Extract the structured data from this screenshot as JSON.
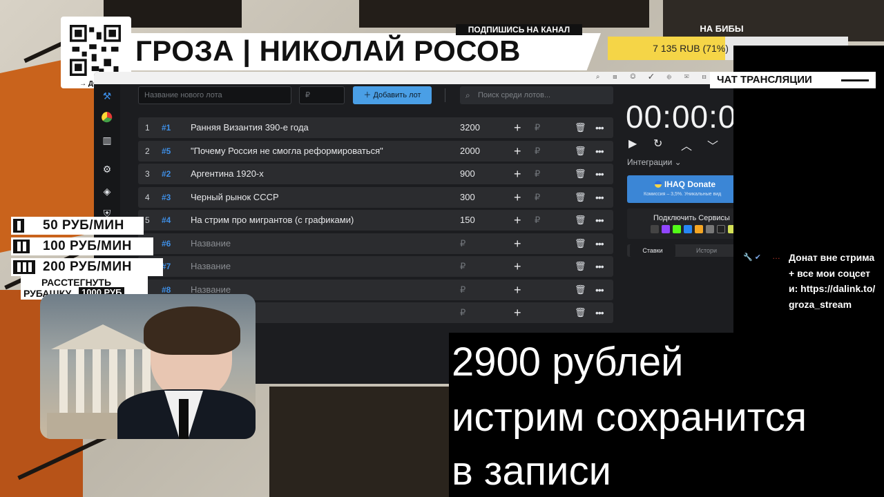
{
  "overlay": {
    "qr_label": "→ ДОНАТ",
    "title": "ГРОЗА | НИКОЛАЙ РОСОВ",
    "subscribe": "ПОДПИШИСЬ НА КАНАЛ",
    "goal": {
      "title": "НА БИБЫ",
      "text": "7 135 RUB (71%)",
      "progress": 0.71
    },
    "prices": [
      {
        "label": "50 РУБ/МИН"
      },
      {
        "label": "100 РУБ/МИН"
      },
      {
        "label": "200 РУБ/МИН"
      }
    ],
    "shirt": {
      "line1": "РАССТЕГНУТЬ",
      "line2": "РУБАШКУ",
      "badge": "1000 РУБ"
    }
  },
  "app": {
    "topbar_icons": "⌕ ⊞ ◎ ✓ ⊕ ✉ ⊟ ⤓",
    "toolbar": {
      "lot_name_placeholder": "Название нового лота",
      "amount_placeholder": "₽",
      "add_button": "Добавить лот",
      "search_placeholder": "Поиск среди лотов..."
    },
    "currency": "₽",
    "lots": [
      {
        "index": "1",
        "id": "#1",
        "name": "Ранняя Византия 390-е года",
        "amount": "3200"
      },
      {
        "index": "2",
        "id": "#5",
        "name": "\"Почему Россия не смогла реформироваться\"",
        "amount": "2000"
      },
      {
        "index": "3",
        "id": "#2",
        "name": "Аргентина 1920-х",
        "amount": "900"
      },
      {
        "index": "4",
        "id": "#3",
        "name": "Черный рынок СССР",
        "amount": "300"
      },
      {
        "index": "5",
        "id": "#4",
        "name": "На стрим про мигрантов (с графиками)",
        "amount": "150"
      },
      {
        "index": "",
        "id": "#6",
        "name": "Название",
        "amount": "₽"
      },
      {
        "index": "",
        "id": "#7",
        "name": "Название",
        "amount": "₽"
      },
      {
        "index": "",
        "id": "#8",
        "name": "Название",
        "amount": "₽"
      },
      {
        "index": "",
        "id": "",
        "name": "",
        "amount": "₽"
      }
    ],
    "timer": "00:00:0",
    "integrations_label": "Интеграции",
    "donate": {
      "title": "IHAQ Donate",
      "subtitle": "Комиссия – 3,5%. Уникальные вид"
    },
    "services_title": "Подключить Сервисы",
    "tabs": {
      "active": "Ставки",
      "other": "Истори"
    }
  },
  "chat": {
    "header": "ЧАТ ТРАНСЛЯЦИИ",
    "user": "…",
    "message": "Донат вне стрима + все мои соцсети: https://dalink.to/groza_stream"
  },
  "subtitles": [
    "2900 рублей",
    "истрим сохранится",
    "в записи"
  ]
}
